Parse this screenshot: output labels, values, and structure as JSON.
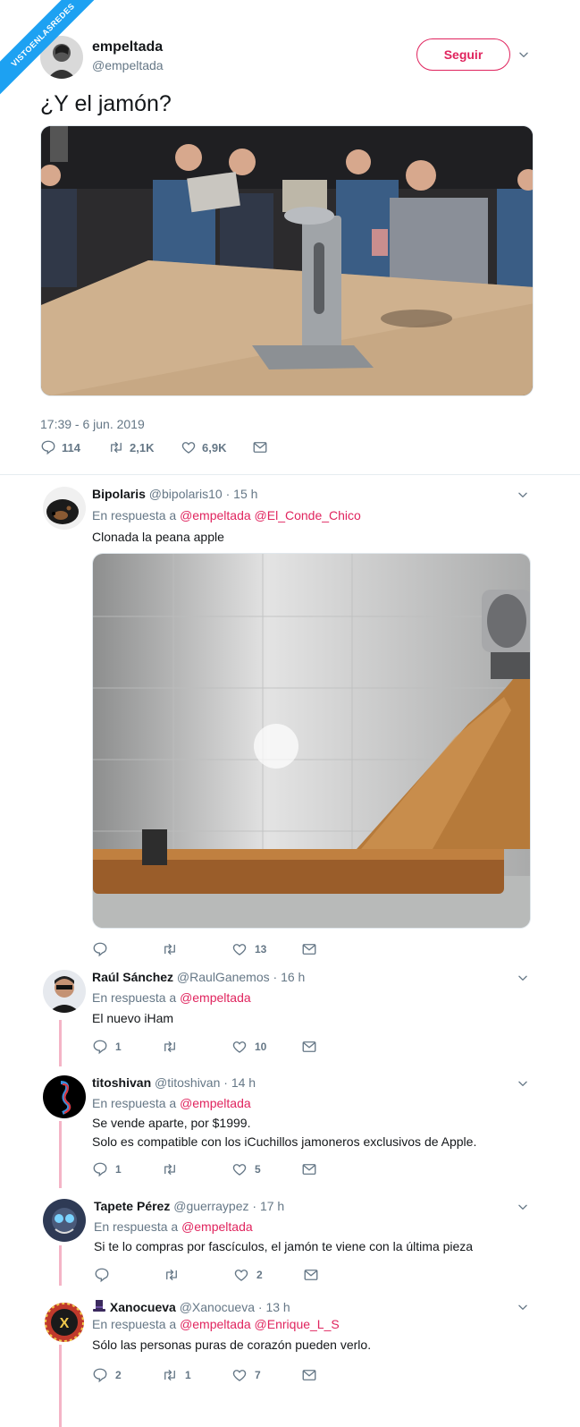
{
  "watermark": "VISTOENLASREDES",
  "tweet": {
    "name": "empeltada",
    "handle": "@empeltada",
    "follow_label": "Seguir",
    "text": "¿Y el jamón?",
    "timestamp": "17:39 - 6 jun. 2019",
    "replies": "114",
    "retweets": "2,1K",
    "likes": "6,9K"
  },
  "replies": [
    {
      "name": "Bipolaris",
      "handle": "@bipolaris10",
      "time": "· 15 h",
      "in_reply_prefix": "En respuesta a",
      "mentions": "@empeltada @El_Conde_Chico",
      "text": "Clonada la peana apple",
      "reply_count": "",
      "retweet_count": "",
      "like_count": "13"
    },
    {
      "name": "Raúl Sánchez",
      "handle": "@RaulGanemos",
      "time": "· 16 h",
      "in_reply_prefix": "En respuesta a",
      "mentions": "@empeltada",
      "text": "El nuevo iHam",
      "reply_count": "1",
      "retweet_count": "",
      "like_count": "10"
    },
    {
      "name": "titoshivan",
      "handle": "@titoshivan",
      "time": "· 14 h",
      "in_reply_prefix": "En respuesta a",
      "mentions": "@empeltada",
      "text": "Se vende aparte, por $1999.",
      "text2": "Solo es compatible con los iCuchillos jamoneros exclusivos de Apple.",
      "reply_count": "1",
      "retweet_count": "",
      "like_count": "5"
    },
    {
      "name": "Tapete Pérez",
      "handle": "@guerraypez",
      "time": "· 17 h",
      "in_reply_prefix": "En respuesta a",
      "mentions": "@empeltada",
      "text": "Si te lo compras por fascículos, el jamón te viene con la última pieza",
      "reply_count": "",
      "retweet_count": "",
      "like_count": "2"
    },
    {
      "name": "Xanocueva",
      "handle": "@Xanocueva",
      "time": "· 13 h",
      "in_reply_prefix": "En respuesta a",
      "mentions": "@empeltada @Enrique_L_S",
      "text": "Sólo las personas puras de corazón pueden verlo.",
      "reply_count": "2",
      "retweet_count": "1",
      "like_count": "7"
    }
  ],
  "icons": {
    "reply": "speech-bubble",
    "retweet": "retweet-arrows",
    "like": "heart",
    "dm": "envelope",
    "more": "chevron-down"
  },
  "colors": {
    "accent": "#e0245e",
    "muted": "#657786",
    "ribbon": "#1da1f2",
    "thread": "#f4b4c6"
  }
}
